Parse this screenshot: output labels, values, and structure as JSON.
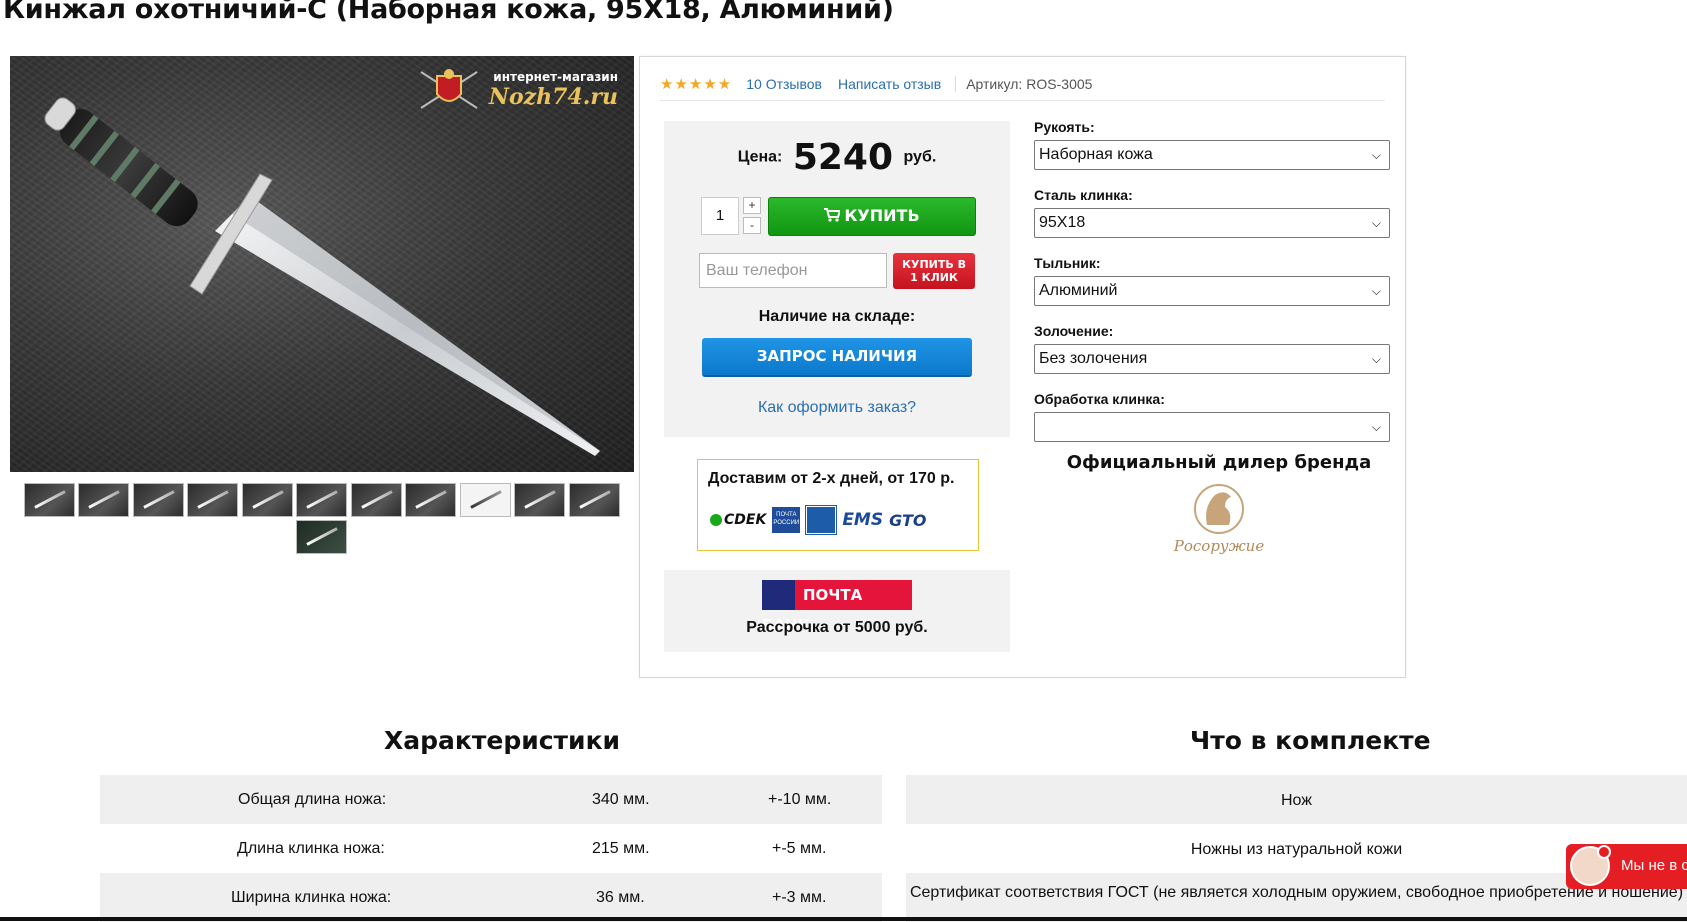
{
  "product": {
    "title": "Кинжал охотничий-С (Наборная кожа, 95Х18, Алюминий)"
  },
  "photo": {
    "logo_small": "интернет-магазин",
    "logo_big": "Nozh74.ru",
    "thumbnail_count": 12
  },
  "reviews": {
    "rating": 5,
    "stars": "★★★★★",
    "count_label": "10 Отзывов",
    "write_label": "Написать отзыв",
    "sku_label": "Артикул:",
    "sku": "ROS-3005"
  },
  "price": {
    "label": "Цена:",
    "value": "5240",
    "currency": "руб."
  },
  "purchase": {
    "quantity": "1",
    "plus": "+",
    "minus": "-",
    "buy_label": "КУПИТЬ",
    "phone_placeholder": "Ваш телефон",
    "one_click_label_1": "КУПИТЬ В",
    "one_click_label_2": "1 КЛИК",
    "stock_label": "Наличие на складе:",
    "request_label": "ЗАПРОС НАЛИЧИЯ",
    "howto_label": "Как оформить заказ?"
  },
  "delivery": {
    "title": "Доставим от 2-х дней, от 170 р.",
    "carriers": [
      "CDEK",
      "ПОЧТА РОССИИ",
      "EMS",
      "GTO"
    ]
  },
  "bank": {
    "logo_text": "ПОЧТА БАНК",
    "installment": "Рассрочка от 5000 руб."
  },
  "options": [
    {
      "label": "Рукоять:",
      "value": "Наборная кожа"
    },
    {
      "label": "Сталь клинка:",
      "value": "95Х18"
    },
    {
      "label": "Тыльник:",
      "value": "Алюминий"
    },
    {
      "label": "Золочение:",
      "value": "Без золочения"
    },
    {
      "label": "Обработка клинка:",
      "value": ""
    }
  ],
  "dealer": {
    "title": "Официальный дилер бренда",
    "brand": "Росоружие"
  },
  "specs": {
    "title": "Характеристики",
    "rows": [
      {
        "name": "Общая длина ножа:",
        "value": "340 мм.",
        "tolerance": "+-10 мм."
      },
      {
        "name": "Длина клинка ножа:",
        "value": "215 мм.",
        "tolerance": "+-5 мм."
      },
      {
        "name": "Ширина клинка ножа:",
        "value": "36 мм.",
        "tolerance": "+-3 мм."
      }
    ]
  },
  "kit": {
    "title": "Что в комплекте",
    "rows": [
      "Нож",
      "Ножны из натуральной кожи",
      "Сертификат соответствия ГОСТ (не является холодным оружием, свободное приобретение и ношение)"
    ]
  },
  "chat": {
    "label": "Мы не в с"
  },
  "colors": {
    "buy_green": "#129612",
    "one_click_red": "#c5141f",
    "request_blue": "#0b79cb",
    "link_blue": "#2a6fb0",
    "star_orange": "#f5a623"
  }
}
